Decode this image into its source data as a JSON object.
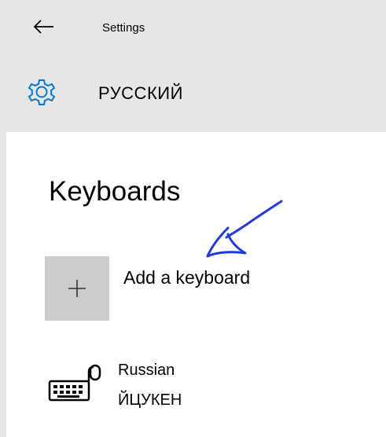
{
  "titlebar": {
    "back_icon": "arrow-left-icon",
    "title": "Settings"
  },
  "page_header": {
    "icon": "gear-icon",
    "title": "РУССКИЙ"
  },
  "section": {
    "heading": "Keyboards"
  },
  "add_keyboard": {
    "icon": "plus-icon",
    "label": "Add a keyboard"
  },
  "keyboards": [
    {
      "icon": "keyboard-icon",
      "name": "Russian",
      "layout": "ЙЦУКЕН"
    }
  ],
  "annotation": {
    "icon": "hand-drawn-arrow-icon",
    "color": "#1e3ad8"
  },
  "colors": {
    "header_background": "#e6e6e6",
    "accent": "#0078d7",
    "tile_background": "#cccccc",
    "annotation": "#1e3ad8"
  }
}
